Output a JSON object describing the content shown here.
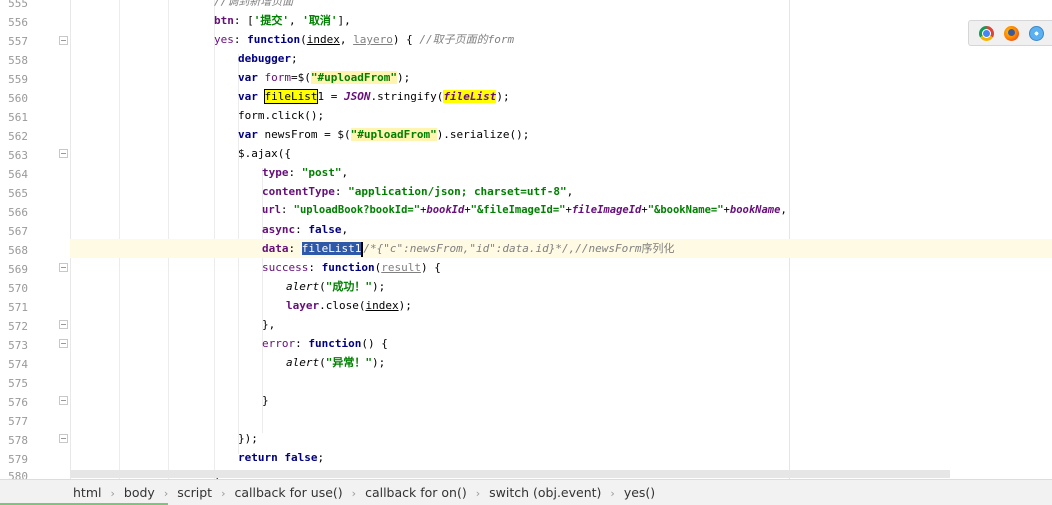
{
  "editor": {
    "line_numbers": [
      "555",
      "556",
      "557",
      "558",
      "559",
      "560",
      "561",
      "562",
      "563",
      "564",
      "565",
      "566",
      "567",
      "568",
      "569",
      "570",
      "571",
      "572",
      "573",
      "574",
      "575",
      "576",
      "577",
      "578",
      "579",
      "580"
    ],
    "tokens": {
      "l555": {
        "comment": "//调到新增页面"
      },
      "l556": {
        "key": "btn",
        "p1": ": [",
        "s1": "'提交'",
        "p2": ", ",
        "s2": "'取消'",
        "p3": "],"
      },
      "l557": {
        "key": "yes",
        "p1": ": ",
        "kw": "function",
        "p2": "(",
        "a1": "index",
        "p3": ", ",
        "a2": "layero",
        "p4": ") { ",
        "comment": "//取子页面的form"
      },
      "l558": {
        "kw": "debugger",
        "p1": ";"
      },
      "l559": {
        "kw": "var",
        "v": " form",
        "p1": "=$(",
        "s": "\"#uploadFrom\"",
        "p2": ");"
      },
      "l560": {
        "kw": "var",
        "sp": " ",
        "v1": "fileList",
        "v2": "1",
        "p1": " = ",
        "obj": "JSON",
        "p2": ".stringify(",
        "v3": "fileList",
        "p3": ");"
      },
      "l561": {
        "code": "form.click();"
      },
      "l562": {
        "kw": "var",
        "v": " newsFrom = $(",
        "s": "\"#uploadFrom\"",
        "p1": ").serialize();"
      },
      "l563": {
        "code": "$.ajax({"
      },
      "l564": {
        "key": "type",
        "p1": ": ",
        "s": "\"post\"",
        "p2": ","
      },
      "l565": {
        "key": "contentType",
        "p1": ": ",
        "s": "\"application/json; charset=utf-8\"",
        "p2": ","
      },
      "l566": {
        "key": "url",
        "p1": ": ",
        "s1": "\"uploadBook?bookId=\"",
        "p2": "+",
        "v1": "bookId",
        "p3": "+",
        "s2": "\"&fileImageId=\"",
        "p4": "+",
        "v2": "fileImageId",
        "p5": "+",
        "s3": "\"&bookName=\"",
        "p6": "+",
        "v3": "bookName",
        "p7": ","
      },
      "l567": {
        "key": "async",
        "p1": ": ",
        "kw": "false",
        "p2": ","
      },
      "l568": {
        "key": "data",
        "p1": ": ",
        "sel": "fileList1",
        "comment": "/*{\"c\":newsFrom,\"id\":data.id}*/,//newsForm",
        "tail": "序列化"
      },
      "l569": {
        "key": "success",
        "p1": ": ",
        "kw": "function",
        "p2": "(",
        "a": "result",
        "p3": ") {"
      },
      "l570": {
        "fn": "alert",
        "p1": "(",
        "s": "\"成功！\"",
        "p2": ");"
      },
      "l571": {
        "obj": "layer",
        "p1": ".close(",
        "a": "index",
        "p2": ");"
      },
      "l572": {
        "code": "},"
      },
      "l573": {
        "key": "error",
        "p1": ": ",
        "kw": "function",
        "p2": "() {"
      },
      "l574": {
        "fn": "alert",
        "p1": "(",
        "s": "\"异常！\"",
        "p2": ");"
      },
      "l576": {
        "code": "}"
      },
      "l578": {
        "code": "});"
      },
      "l579": {
        "kw": "return",
        "sp": " ",
        "kw2": "false",
        "p1": ";"
      },
      "l580": {
        "code": "}"
      }
    }
  },
  "statusbar": {
    "breadcrumbs": [
      "html",
      "body",
      "script",
      "callback for use()",
      "callback for on()",
      "switch (obj.event)",
      "yes()"
    ]
  },
  "browser_icons": [
    "chrome-icon",
    "firefox-icon",
    "safari-icon"
  ],
  "colors": {
    "keyword": "#000080",
    "string": "#008000",
    "property": "#660e7a",
    "comment": "#808080",
    "selection": "#2e59a8",
    "highlight": "#ffff00",
    "current_line": "#fffae3"
  }
}
